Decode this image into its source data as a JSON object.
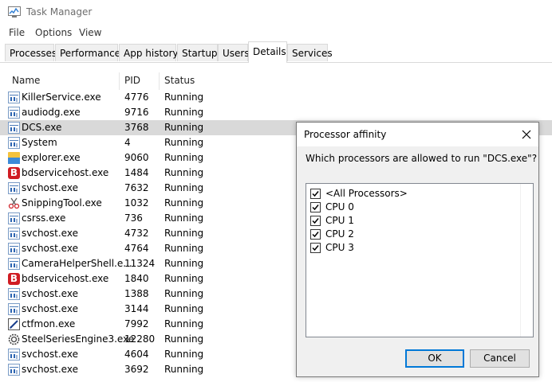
{
  "window": {
    "title": "Task Manager"
  },
  "menu": [
    "File",
    "Options",
    "View"
  ],
  "tabs": [
    "Processes",
    "Performance",
    "App history",
    "Startup",
    "Users",
    "Details",
    "Services"
  ],
  "active_tab": "Details",
  "columns": {
    "name": "Name",
    "pid": "PID",
    "status": "Status"
  },
  "processes": [
    {
      "name": "KillerService.exe",
      "pid": "4776",
      "status": "Running",
      "icon": "service-icon"
    },
    {
      "name": "audiodg.exe",
      "pid": "9716",
      "status": "Running",
      "icon": "service-icon"
    },
    {
      "name": "DCS.exe",
      "pid": "3768",
      "status": "Running",
      "icon": "service-icon"
    },
    {
      "name": "System",
      "pid": "4",
      "status": "Running",
      "icon": "service-icon"
    },
    {
      "name": "explorer.exe",
      "pid": "9060",
      "status": "Running",
      "icon": "folder-icon"
    },
    {
      "name": "bdservicehost.exe",
      "pid": "1484",
      "status": "Running",
      "icon": "bitdefender-icon"
    },
    {
      "name": "svchost.exe",
      "pid": "7632",
      "status": "Running",
      "icon": "service-icon"
    },
    {
      "name": "SnippingTool.exe",
      "pid": "1032",
      "status": "Running",
      "icon": "scissors-icon"
    },
    {
      "name": "csrss.exe",
      "pid": "736",
      "status": "Running",
      "icon": "service-icon"
    },
    {
      "name": "svchost.exe",
      "pid": "4732",
      "status": "Running",
      "icon": "service-icon"
    },
    {
      "name": "svchost.exe",
      "pid": "4764",
      "status": "Running",
      "icon": "service-icon"
    },
    {
      "name": "CameraHelperShell.e...",
      "pid": "11324",
      "status": "Running",
      "icon": "service-icon"
    },
    {
      "name": "bdservicehost.exe",
      "pid": "1840",
      "status": "Running",
      "icon": "bitdefender-icon"
    },
    {
      "name": "svchost.exe",
      "pid": "1388",
      "status": "Running",
      "icon": "service-icon"
    },
    {
      "name": "svchost.exe",
      "pid": "3144",
      "status": "Running",
      "icon": "service-icon"
    },
    {
      "name": "ctfmon.exe",
      "pid": "7992",
      "status": "Running",
      "icon": "pen-icon"
    },
    {
      "name": "SteelSeriesEngine3.exe",
      "pid": "12280",
      "status": "Running",
      "icon": "gear-icon"
    },
    {
      "name": "svchost.exe",
      "pid": "4604",
      "status": "Running",
      "icon": "service-icon"
    },
    {
      "name": "svchost.exe",
      "pid": "3692",
      "status": "Running",
      "icon": "service-icon"
    }
  ],
  "selected_process": "DCS.exe",
  "dialog": {
    "title": "Processor affinity",
    "question": "Which processors are allowed to run \"DCS.exe\"?",
    "options": [
      {
        "label": "<All Processors>",
        "checked": true
      },
      {
        "label": "CPU 0",
        "checked": true
      },
      {
        "label": "CPU 1",
        "checked": true
      },
      {
        "label": "CPU 2",
        "checked": true
      },
      {
        "label": "CPU 3",
        "checked": true
      }
    ],
    "ok_label": "OK",
    "cancel_label": "Cancel",
    "accent": "#0078d7"
  }
}
